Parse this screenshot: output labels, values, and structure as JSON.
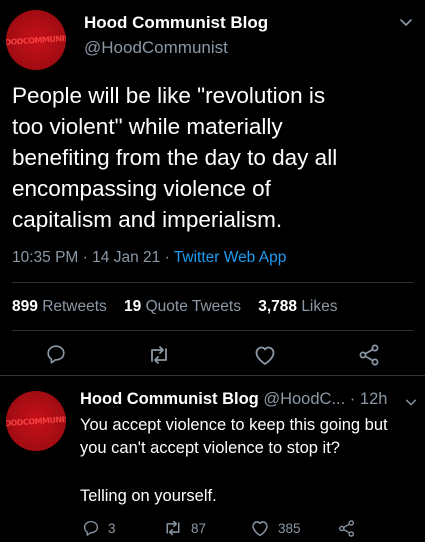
{
  "main_tweet": {
    "avatar_text": "HOODCOMMUNIST",
    "display_name": "Hood Communist Blog",
    "handle": "@HoodCommunist",
    "text": "People will be like \"revolution is too violent\" while materially benefiting from the day to day all encompassing violence of capitalism and imperialism.",
    "time": "10:35 PM",
    "date": "14 Jan 21",
    "separator": "·",
    "source": "Twitter Web App",
    "stats": {
      "retweets_count": "899",
      "retweets_label": "Retweets",
      "quotes_count": "19",
      "quotes_label": "Quote Tweets",
      "likes_count": "3,788",
      "likes_label": "Likes"
    }
  },
  "reply_tweet": {
    "avatar_text": "HOODCOMMUNIST",
    "display_name": "Hood Communist Blog",
    "handle": "@HoodC...",
    "separator": "·",
    "age": "12h",
    "line1": "You accept violence to keep this going but you can't accept violence to stop it?",
    "line2": "Telling on yourself.",
    "reply_count": "3",
    "retweet_count": "87",
    "like_count": "385"
  },
  "colors": {
    "background": "#000000",
    "text": "#ffffff",
    "muted": "#8b98a5",
    "link": "#1d9bf0",
    "avatar": "#c8101a"
  },
  "icons": [
    "chevron-down-icon",
    "reply-icon",
    "retweet-icon",
    "like-icon",
    "share-icon"
  ]
}
